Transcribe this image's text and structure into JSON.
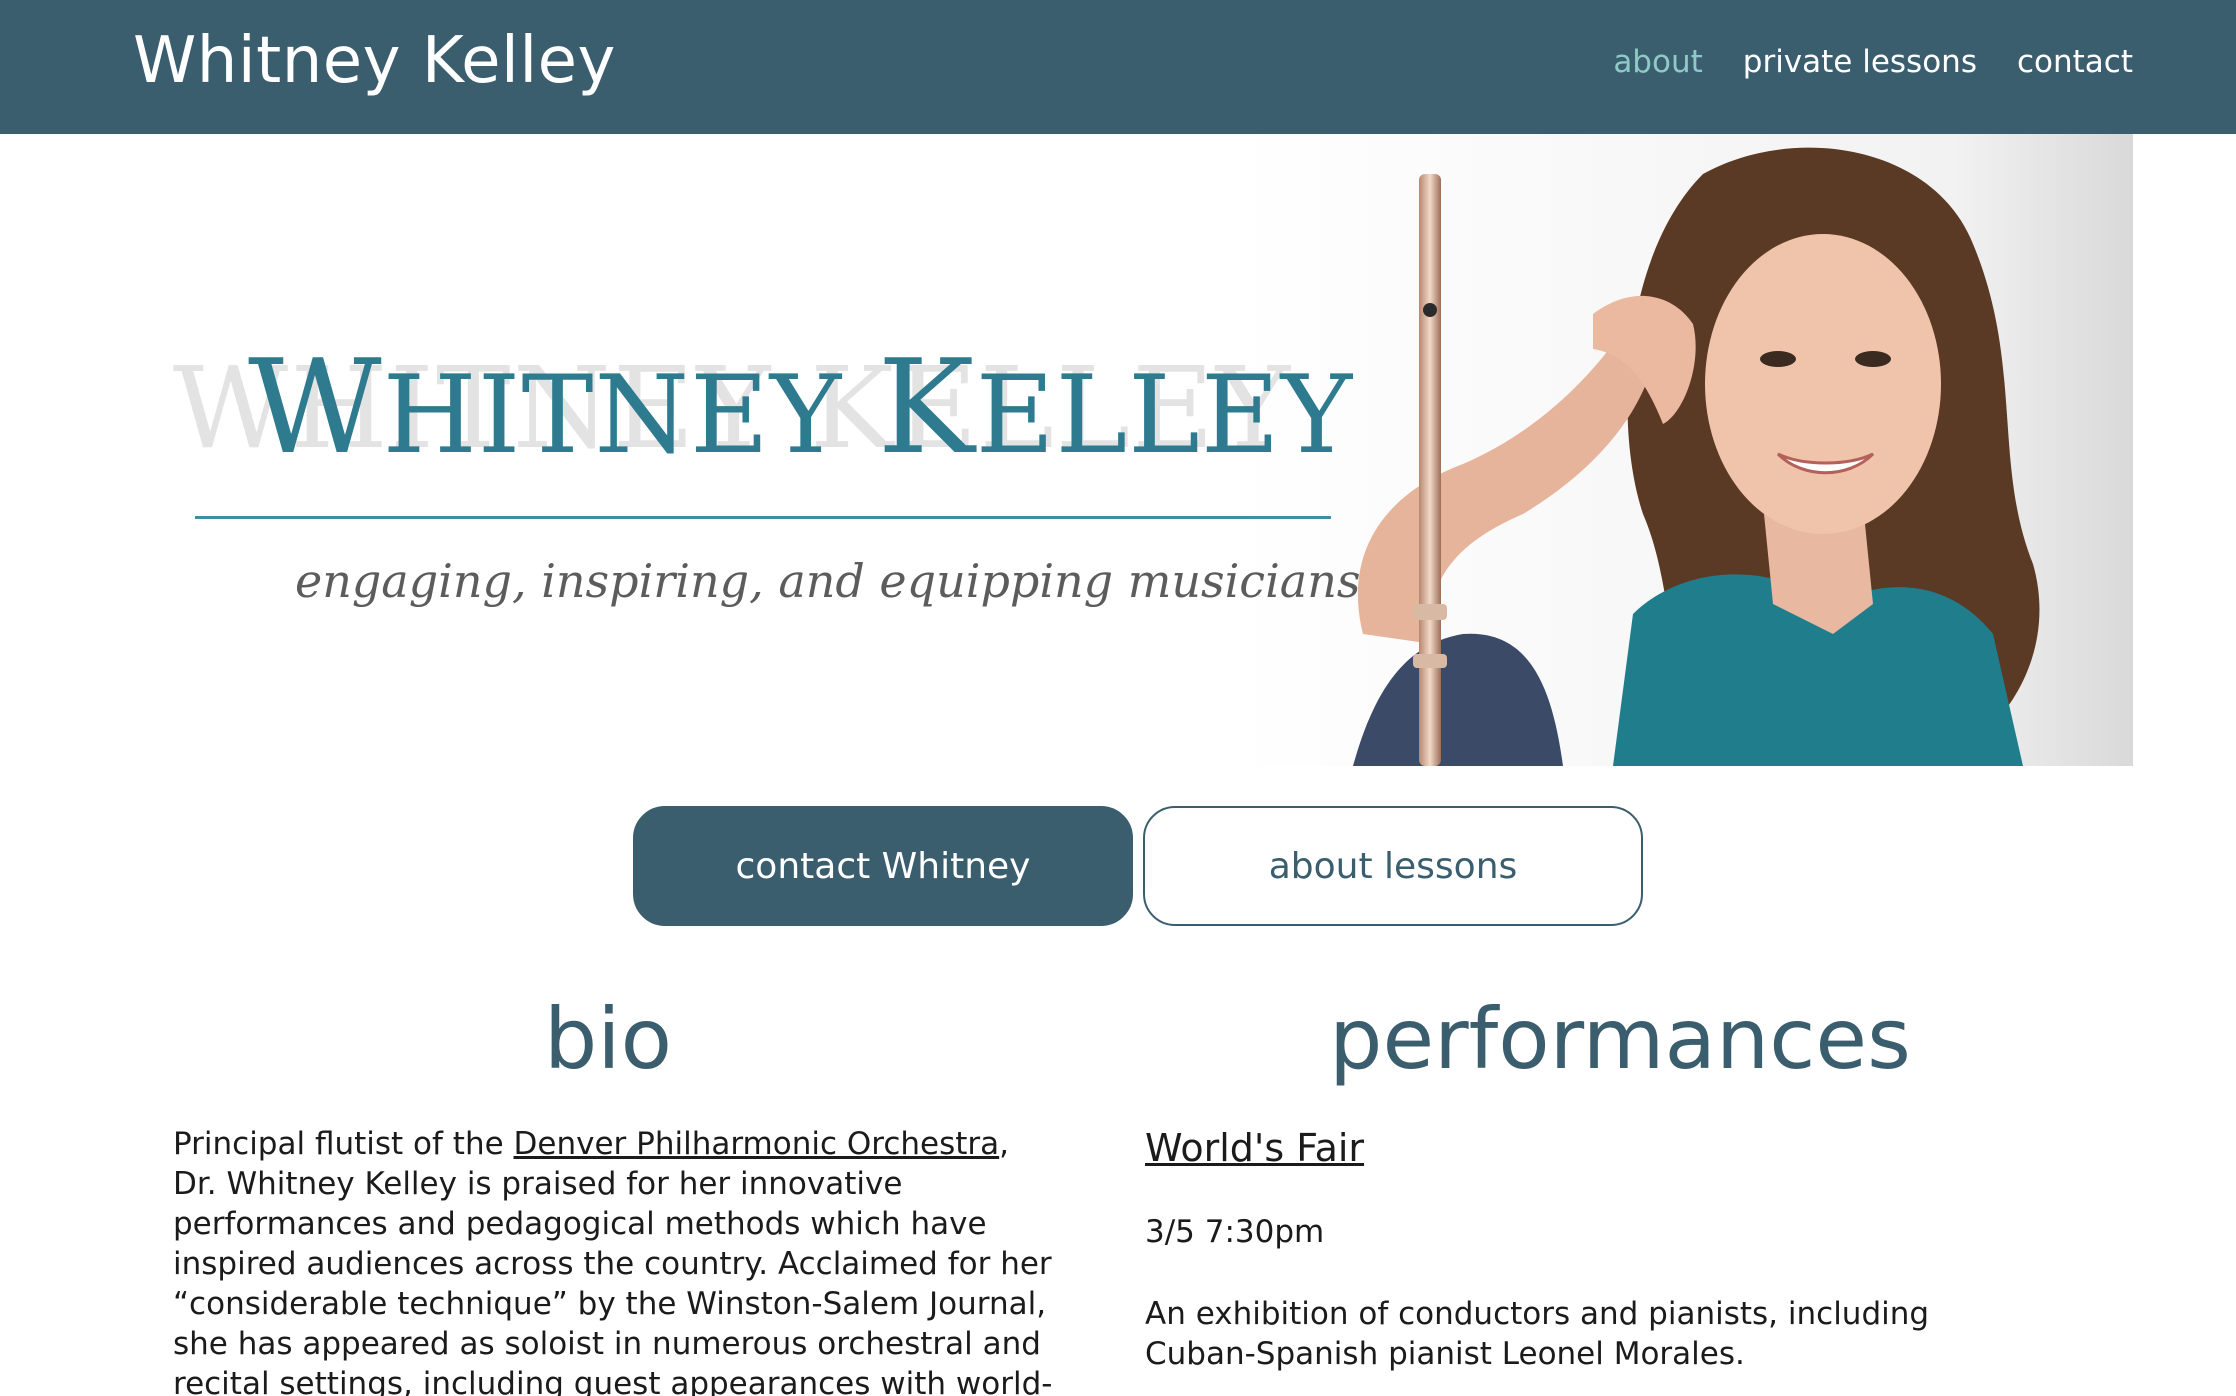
{
  "header": {
    "site_title": "Whitney Kelley",
    "nav": [
      {
        "label": "about",
        "active": true
      },
      {
        "label": "private lessons",
        "active": false
      },
      {
        "label": "contact",
        "active": false
      }
    ]
  },
  "hero": {
    "title_first": "Whitney",
    "title_last": "Kelley",
    "ghost_text": "WHITNEY KELLEY",
    "tagline": "engaging, inspiring, and equipping musicians"
  },
  "buttons": {
    "contact_label": "contact Whitney",
    "lessons_label": "about lessons"
  },
  "bio": {
    "heading": "bio",
    "text_before_link": "Principal flutist of the ",
    "link_text": "Denver Philharmonic Orchestra",
    "text_after_link": ", Dr. Whitney Kelley is praised for her innovative performances and pedagogical methods which have inspired audiences across the country. Acclaimed for her “considerable technique” by the Winston-Salem Journal, she has appeared as soloist in numerous orchestral and recital settings, including guest appearances with world-"
  },
  "performances": {
    "heading": "performances",
    "events": [
      {
        "title": "World's Fair",
        "date": "3/5 7:30pm",
        "description": "An exhibition of conductors and pianists, including Cuban-Spanish pianist Leonel Morales."
      }
    ]
  },
  "colors": {
    "header_bg": "#3b5e6f",
    "nav_active": "#8fc9c6",
    "hero_title": "#2e7b90",
    "heading": "#3b5e6f"
  }
}
